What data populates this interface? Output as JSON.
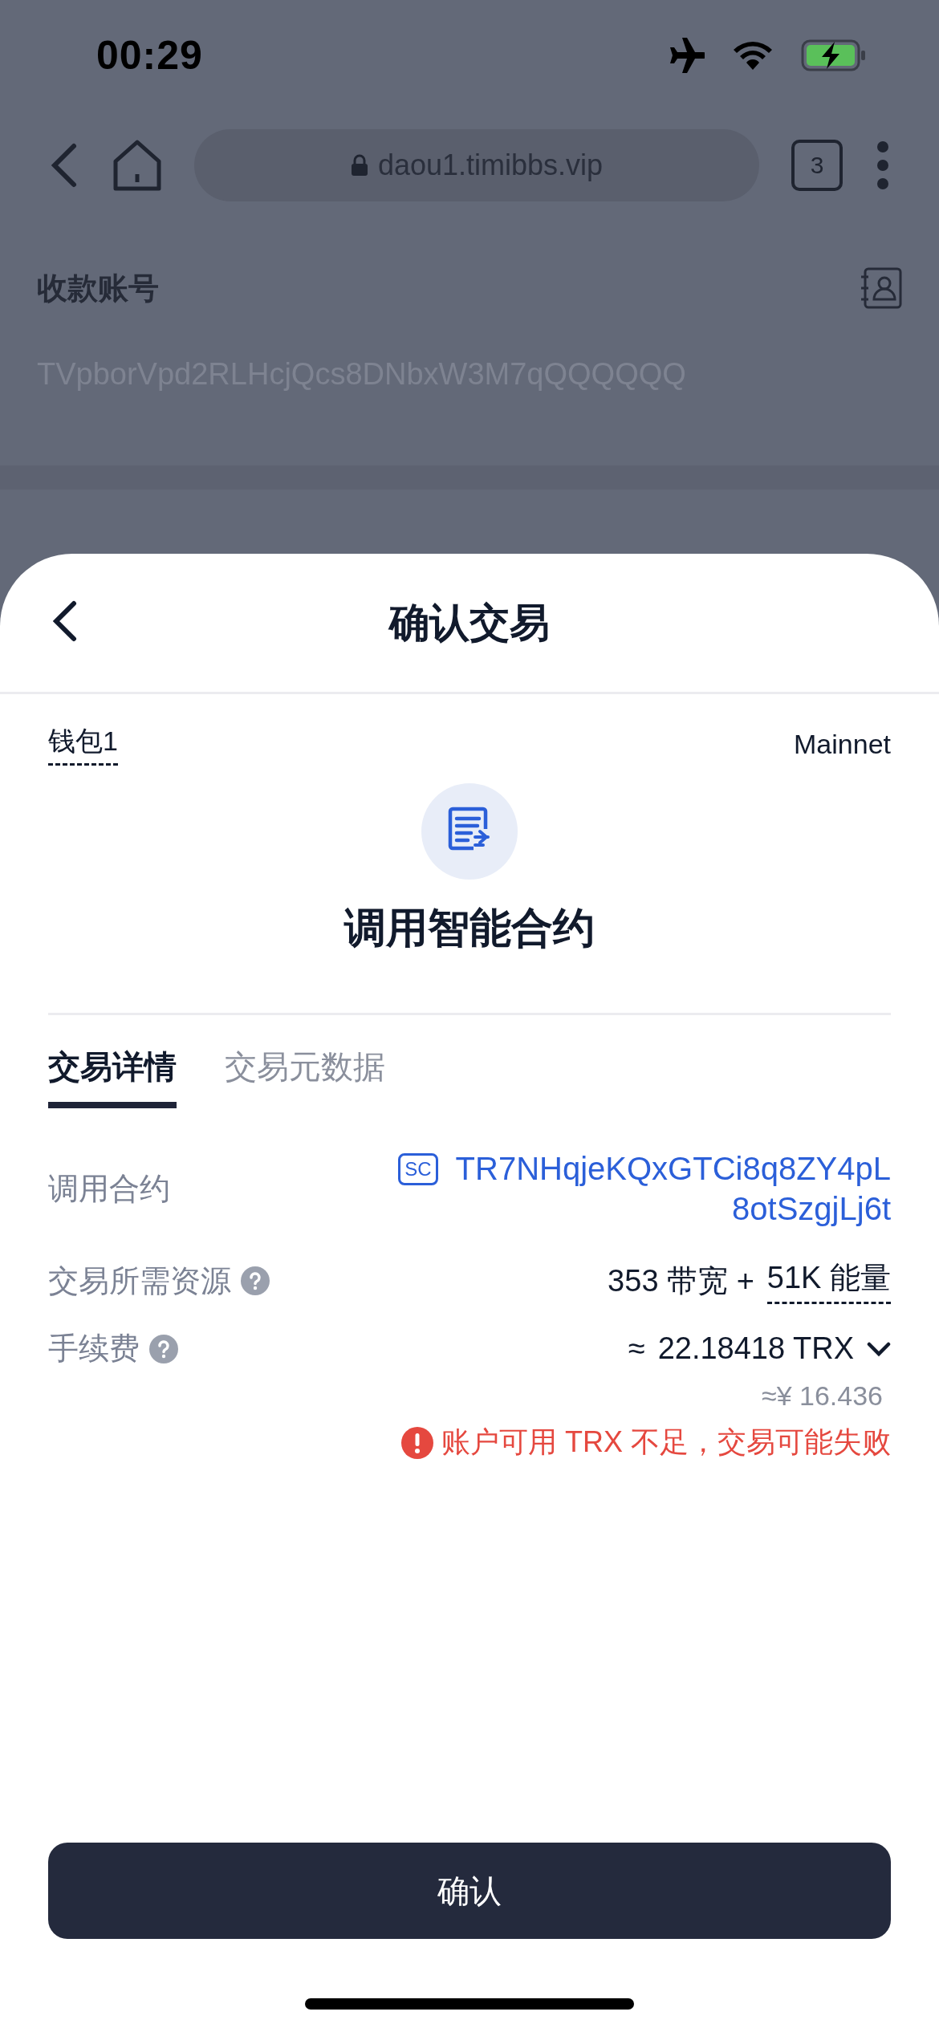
{
  "status_bar": {
    "time": "00:29"
  },
  "browser": {
    "url": "daou1.timibbs.vip",
    "tab_count": "3"
  },
  "background_form": {
    "recipient_label": "收款账号",
    "recipient_value": "TVpborVpd2RLHcjQcs8DNbxW3M7qQQQQQQ"
  },
  "sheet": {
    "title": "确认交易",
    "wallet": "钱包1",
    "network": "Mainnet",
    "action": "调用智能合约",
    "tabs": [
      {
        "label": "交易详情",
        "selected": true
      },
      {
        "label": "交易元数据",
        "selected": false
      }
    ],
    "contract": {
      "label": "调用合约",
      "badge": "SC",
      "address_lines": [
        "TR7NHqjeKQxGTCi8q8ZY4pL",
        "8otSzgjLj6t"
      ]
    },
    "resources": {
      "label": "交易所需资源",
      "bandwidth": "353 带宽 +",
      "energy": "51K 能量"
    },
    "fee": {
      "label": "手续费",
      "approx": "≈",
      "value": "22.18418 TRX",
      "fiat": "≈¥ 16.436",
      "warning": "账户可用 TRX 不足，交易可能失败"
    },
    "confirm_button": "确认"
  }
}
